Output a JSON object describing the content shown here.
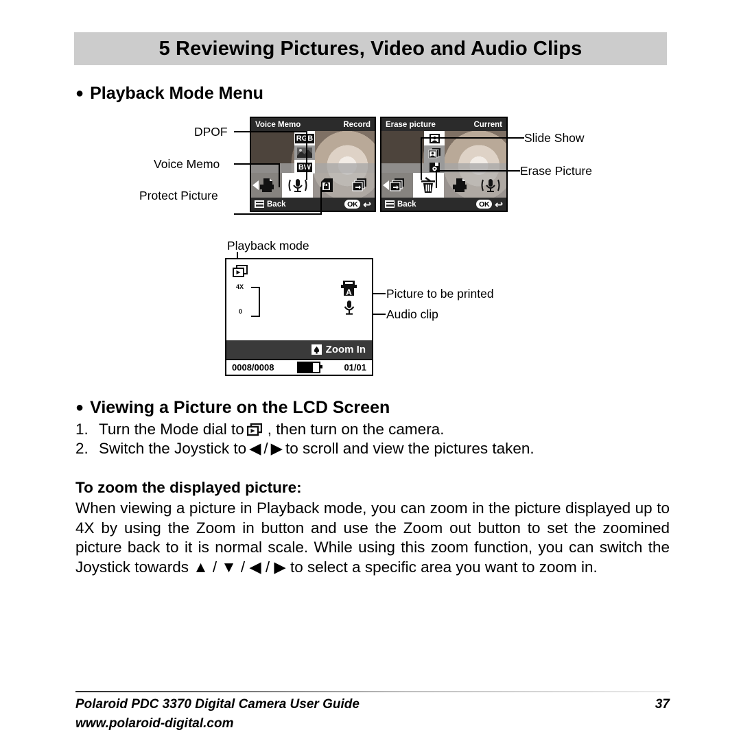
{
  "header": {
    "chapter_title": "5 Reviewing Pictures, Video and Audio Clips"
  },
  "sections": {
    "playback_menu_heading": "Playback Mode Menu",
    "viewing_heading": "Viewing a Picture on the LCD Screen",
    "zoom_subheading": "To zoom the displayed picture:"
  },
  "callouts": {
    "left": [
      {
        "label": "DPOF"
      },
      {
        "label": "Voice Memo"
      },
      {
        "label": "Protect Picture"
      }
    ],
    "right": [
      {
        "label": "Slide Show"
      },
      {
        "label": "Erase Picture"
      }
    ],
    "playback_top": "Playback mode",
    "playback_right": [
      {
        "label": "Picture to be printed"
      },
      {
        "label": "Audio clip"
      }
    ]
  },
  "lcd_voice_memo": {
    "title": "Voice Memo",
    "status": "Record",
    "back_label": "Back",
    "ok_label": "OK",
    "submenu": [
      "RGB",
      "",
      "BW"
    ],
    "icons": [
      "printer-icon",
      "microphone-icon",
      "lock-icon",
      "slideshow-icon"
    ],
    "selected_index": 1
  },
  "lcd_erase": {
    "title": "Erase picture",
    "status": "Current",
    "back_label": "Back",
    "ok_label": "OK",
    "submenu": [
      "single-picture-icon",
      "multi-picture-icon",
      "memory-card-icon"
    ],
    "icons": [
      "slideshow-icon",
      "trash-icon",
      "printer-icon",
      "microphone-icon"
    ],
    "selected_index": 1
  },
  "lcd_playback": {
    "mode_icon": "playback-mode-icon",
    "zoom_max": "4X",
    "zoom_min": "0",
    "zoom_bar_label": "Zoom In",
    "frame_counter": "0008/0008",
    "folder_counter": "01/01",
    "battery_icon": "battery-icon",
    "print_icon": "print-auto-icon",
    "audio_icon": "microphone-icon"
  },
  "steps": [
    {
      "number": "1.",
      "text_before": "Turn the Mode dial to",
      "icon": "playback-mode-icon",
      "text_after": ", then turn on the camera."
    },
    {
      "number": "2.",
      "text_before": "Switch the Joystick to",
      "icon_left": "left-arrow-icon",
      "separator": "/",
      "icon_right": "right-arrow-icon",
      "text_after": "to scroll and view the pictures taken."
    }
  ],
  "paragraph": {
    "part1": "When viewing a picture in Playback mode, you can zoom in the picture displayed up to 4X by using the Zoom in button and use the Zoom out button to set the zoomined picture back to it is normal scale. While using this zoom function, you can switch the Joystick towards",
    "arrows": "▲ / ▼ / ◀ / ▶",
    "part2": "to select a specific area you want to zoom in."
  },
  "footer": {
    "line1": "Polaroid PDC 3370 Digital Camera User Guide",
    "line2": "www.polaroid-digital.com",
    "page_number": "37"
  },
  "colors": {
    "band": "#cccccc",
    "text": "#000000",
    "lcd_bar": "#2b2b2b"
  }
}
